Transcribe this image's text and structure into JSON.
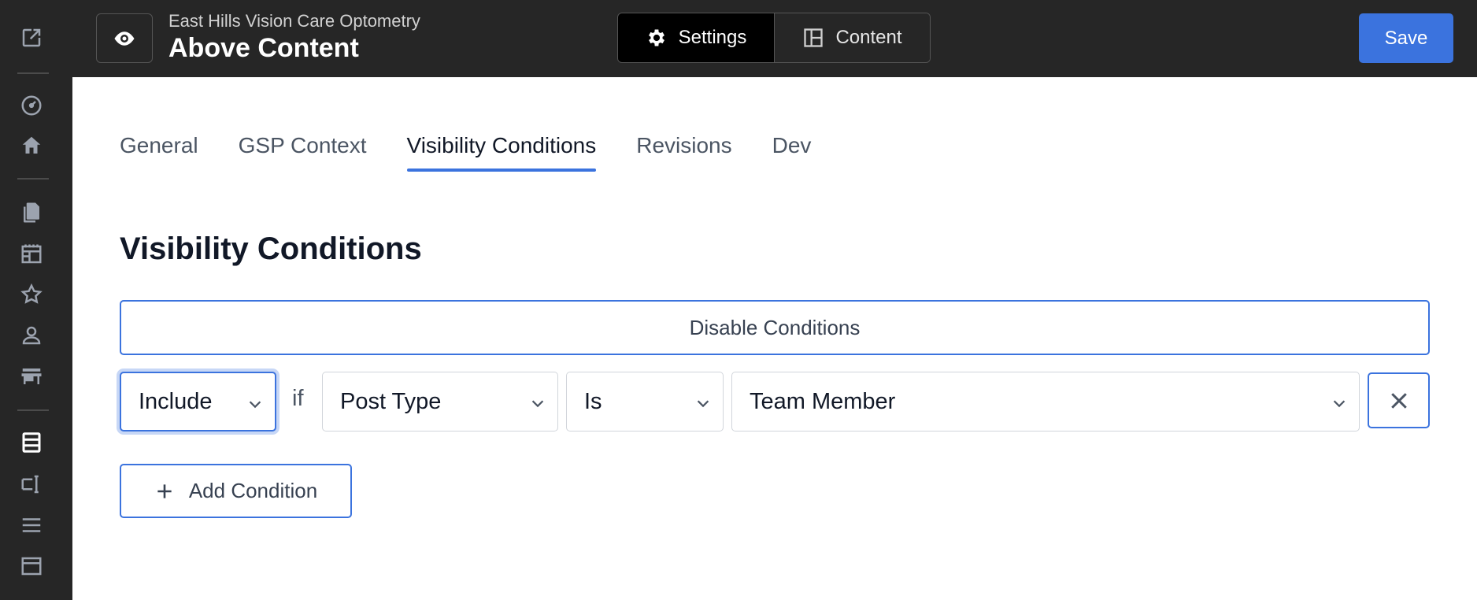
{
  "sidebar": {
    "items": [
      {
        "icon": "external-edit-icon"
      },
      {
        "icon": "dashboard-icon"
      },
      {
        "icon": "home-icon"
      },
      {
        "icon": "pages-icon"
      },
      {
        "icon": "calendar-icon"
      },
      {
        "icon": "star-icon"
      },
      {
        "icon": "user-icon"
      },
      {
        "icon": "store-icon"
      },
      {
        "icon": "list-active-icon"
      },
      {
        "icon": "text-field-icon"
      },
      {
        "icon": "menu-lines-icon"
      },
      {
        "icon": "template-icon"
      }
    ]
  },
  "header": {
    "site_name": "East Hills Vision Care Optometry",
    "page_title": "Above Content",
    "modes": [
      {
        "label": "Settings",
        "icon": "gear-icon",
        "active": true
      },
      {
        "label": "Content",
        "icon": "layout-icon",
        "active": false
      }
    ],
    "save_label": "Save"
  },
  "tabs": [
    "General",
    "GSP Context",
    "Visibility Conditions",
    "Revisions",
    "Dev"
  ],
  "active_tab": "Visibility Conditions",
  "main": {
    "title": "Visibility Conditions",
    "disable_label": "Disable Conditions",
    "condition": {
      "mode": "Include",
      "if_label": "if",
      "field": "Post Type",
      "operator": "Is",
      "value": "Team Member"
    },
    "add_label": "Add Condition"
  },
  "colors": {
    "accent": "#3b73de",
    "dark_bg": "#262626",
    "sidebar_icon": "#9ca3af"
  }
}
